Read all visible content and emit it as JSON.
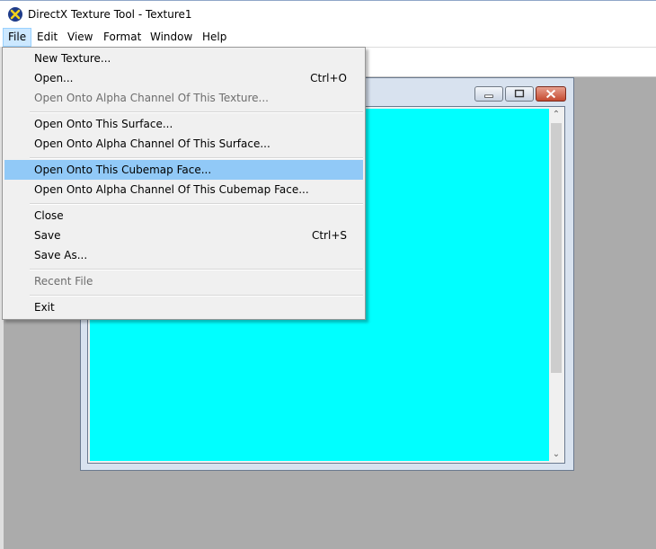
{
  "window": {
    "title": "DirectX Texture Tool - Texture1",
    "icon": "directx-icon"
  },
  "menubar": {
    "items": [
      {
        "label": "File",
        "active": true
      },
      {
        "label": "Edit"
      },
      {
        "label": "View"
      },
      {
        "label": "Format"
      },
      {
        "label": "Window"
      },
      {
        "label": "Help"
      }
    ]
  },
  "file_menu": {
    "items": [
      {
        "label": "New Texture...",
        "shortcut": "",
        "enabled": true
      },
      {
        "label": "Open...",
        "shortcut": "Ctrl+O",
        "enabled": true
      },
      {
        "label": "Open Onto Alpha Channel Of This Texture...",
        "shortcut": "",
        "enabled": false
      },
      {
        "label": "Open Onto This Surface...",
        "shortcut": "",
        "enabled": true
      },
      {
        "label": "Open Onto Alpha Channel Of This Surface...",
        "shortcut": "",
        "enabled": true
      },
      {
        "label": "Open Onto This Cubemap Face...",
        "shortcut": "",
        "enabled": true,
        "highlighted": true
      },
      {
        "label": "Open Onto Alpha Channel Of This Cubemap Face...",
        "shortcut": "",
        "enabled": true
      },
      {
        "label": "Close",
        "shortcut": "",
        "enabled": true
      },
      {
        "label": "Save",
        "shortcut": "Ctrl+S",
        "enabled": true
      },
      {
        "label": "Save As...",
        "shortcut": "",
        "enabled": true
      },
      {
        "label": "Recent File",
        "shortcut": "",
        "enabled": false
      },
      {
        "label": "Exit",
        "shortcut": "",
        "enabled": true
      }
    ]
  },
  "texture_window": {
    "fill_color": "#00ffff"
  },
  "colors": {
    "mdi_background": "#ababab",
    "menu_highlight": "#91c9f7",
    "menubar_active": "#cce8ff"
  }
}
